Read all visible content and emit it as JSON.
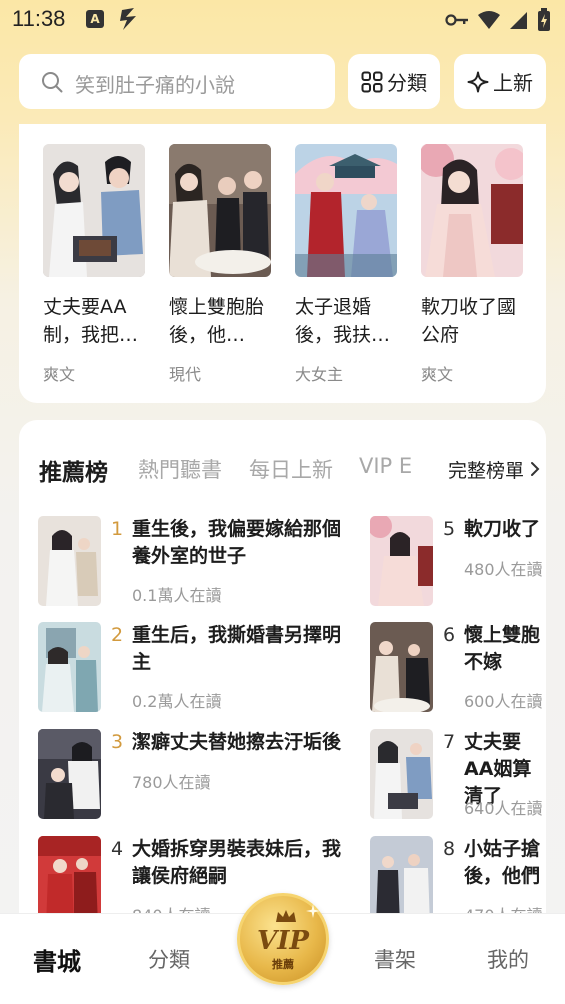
{
  "status": {
    "time": "11:38"
  },
  "search": {
    "placeholder": "笑到肚子痛的小說"
  },
  "buttons": {
    "category": "分類",
    "new": "上新"
  },
  "top_books": [
    {
      "title": "丈夫要AA制，我把…",
      "genre": "爽文"
    },
    {
      "title": "懷上雙胞胎後，他…",
      "genre": "現代"
    },
    {
      "title": "太子退婚後，我扶…",
      "genre": "大女主"
    },
    {
      "title": "軟刀收了國公府",
      "genre": "爽文"
    }
  ],
  "rank_tabs": [
    "推薦榜",
    "熱門聽書",
    "每日上新",
    "VIP E"
  ],
  "full_list": "完整榜單",
  "rank_left": [
    {
      "num": "1",
      "title": "重生後，我偏要嫁給那個養外室的世子",
      "reads": "0.1萬人在讀"
    },
    {
      "num": "2",
      "title": "重生后，我撕婚書另擇明主",
      "reads": "0.2萬人在讀"
    },
    {
      "num": "3",
      "title": "潔癖丈夫替她擦去汙垢後",
      "reads": "780人在讀"
    },
    {
      "num": "4",
      "title": "大婚拆穿男裝表妹后，我讓侯府絕嗣",
      "reads": "840人在讀"
    }
  ],
  "rank_right": [
    {
      "num": "5",
      "title": "軟刀收了",
      "reads": "480人在讀"
    },
    {
      "num": "6",
      "title": "懷上雙胞不嫁",
      "reads": "600人在讀"
    },
    {
      "num": "7",
      "title": "丈夫要AA姻算清了",
      "reads": "640人在讀"
    },
    {
      "num": "8",
      "title": "小姑子搶後，他們",
      "reads": "470人在讀"
    }
  ],
  "nav": {
    "bookstore": "書城",
    "category": "分類",
    "vip": "VIP",
    "vip_sub": "推薦",
    "shelf": "書架",
    "mine": "我的"
  },
  "colors": {
    "accent_gold": "#d29a3e",
    "bg_top": "#fbe7a6"
  }
}
